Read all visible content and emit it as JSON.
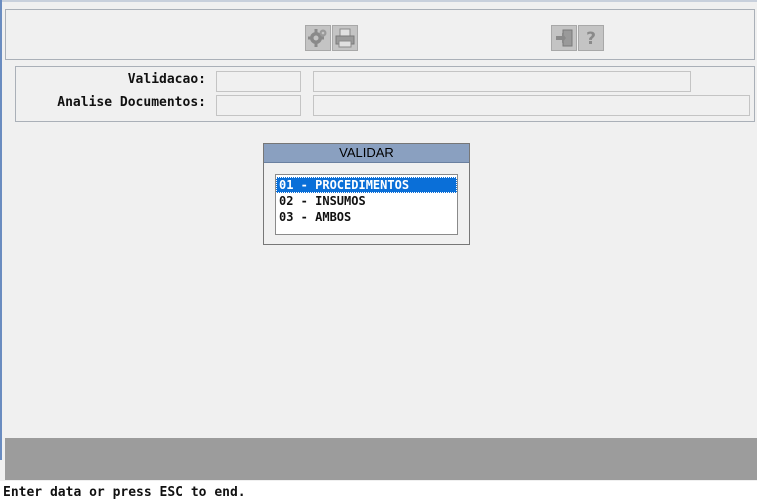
{
  "window": {
    "title_fragment": "- - -- ---- -----"
  },
  "toolbar": {
    "buttons": [
      {
        "icon": "settings-gear-icon"
      },
      {
        "icon": "printer-icon"
      },
      {
        "icon": "exit-door-icon"
      },
      {
        "icon": "help-question-icon"
      }
    ]
  },
  "fields": {
    "validacao_label": "Validacao:",
    "analise_label": "Analise Documentos:"
  },
  "menu": {
    "title": "VALIDAR",
    "items": [
      "01 - PROCEDIMENTOS",
      "02 - INSUMOS",
      "03 - AMBOS"
    ],
    "selected_index": 0
  },
  "status": {
    "message": "Enter data or press ESC to end."
  },
  "colors": {
    "selection": "#0a6fd8",
    "menu_title_bar": "#8aa0c0",
    "status_bar": "#9c9c9c"
  }
}
